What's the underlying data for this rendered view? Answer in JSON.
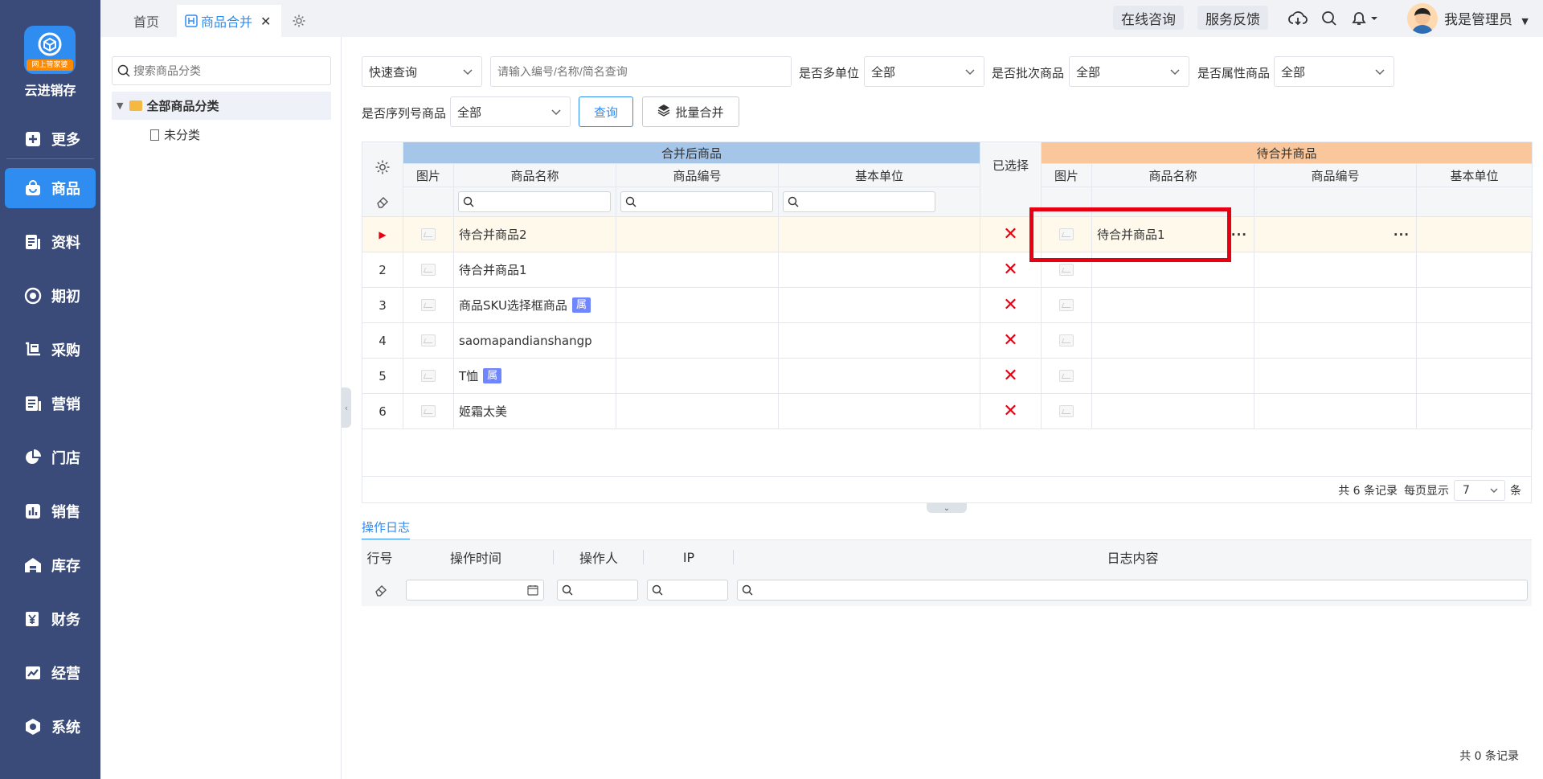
{
  "sidebar": {
    "logo_tag": "网上管家婆",
    "brand": "云进销存",
    "items": [
      {
        "label": "更多",
        "icon": "plus-square-icon"
      },
      {
        "label": "商品",
        "icon": "bag-icon"
      },
      {
        "label": "资料",
        "icon": "document-icon"
      },
      {
        "label": "期初",
        "icon": "target-icon"
      },
      {
        "label": "采购",
        "icon": "cart-icon"
      },
      {
        "label": "营销",
        "icon": "list-icon"
      },
      {
        "label": "门店",
        "icon": "pie-icon"
      },
      {
        "label": "销售",
        "icon": "bar-chart-icon"
      },
      {
        "label": "库存",
        "icon": "warehouse-icon"
      },
      {
        "label": "财务",
        "icon": "yuan-icon"
      },
      {
        "label": "经营",
        "icon": "trend-icon"
      },
      {
        "label": "系统",
        "icon": "hexagon-gear-icon"
      }
    ]
  },
  "tabs": {
    "home": "首页",
    "merge": "商品合并",
    "close": "✕"
  },
  "topbar": {
    "consult": "在线咨询",
    "feedback": "服务反馈",
    "user": "我是管理员"
  },
  "category": {
    "search_placeholder": "搜索商品分类",
    "root": "全部商品分类",
    "child": "未分类"
  },
  "filters": {
    "quick_query": "快速查询",
    "keyword_placeholder": "请输入编号/名称/简名查询",
    "multi_unit_label": "是否多单位",
    "multi_unit_value": "全部",
    "batch_label": "是否批次商品",
    "batch_value": "全部",
    "attr_label": "是否属性商品",
    "attr_value": "全部",
    "serial_label": "是否序列号商品",
    "serial_value": "全部",
    "query_btn": "查询",
    "batch_merge_btn": "批量合并"
  },
  "grid": {
    "group_left": "合并后商品",
    "group_selected": "已选择",
    "group_right": "待合并商品",
    "cols_left": [
      "图片",
      "商品名称",
      "商品编号",
      "基本单位"
    ],
    "cols_right": [
      "图片",
      "商品名称",
      "商品编号",
      "基本单位"
    ],
    "rows": [
      {
        "no": "▶",
        "name": "待合并商品2",
        "badge": "",
        "right_name": "待合并商品1"
      },
      {
        "no": "2",
        "name": "待合并商品1",
        "badge": "",
        "right_name": ""
      },
      {
        "no": "3",
        "name": "商品SKU选择框商品",
        "badge": "属",
        "right_name": ""
      },
      {
        "no": "4",
        "name": "saomapandianshangp",
        "badge": "",
        "right_name": ""
      },
      {
        "no": "5",
        "name": "T恤",
        "badge": "属",
        "right_name": ""
      },
      {
        "no": "6",
        "name": "姬霜太美",
        "badge": "",
        "right_name": ""
      }
    ],
    "remove_mark": "✕",
    "ellipsis": "···",
    "pager": {
      "total": "共 6 条记录",
      "per_page_label": "每页显示",
      "per_page": "7",
      "unit": "条"
    }
  },
  "log": {
    "tab": "操作日志",
    "cols": [
      "行号",
      "操作时间",
      "操作人",
      "IP",
      "日志内容"
    ],
    "total": "共 0 条记录"
  }
}
